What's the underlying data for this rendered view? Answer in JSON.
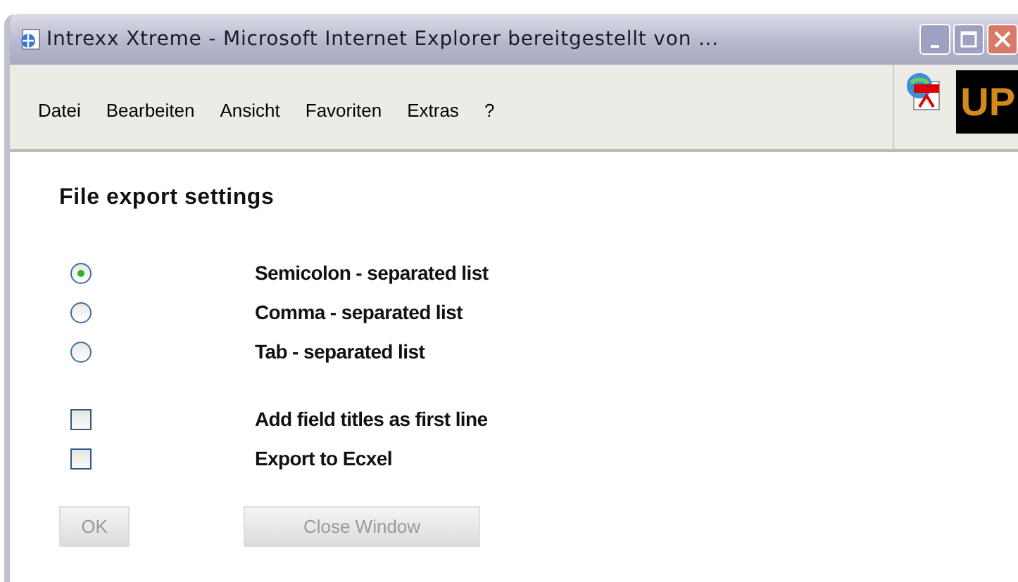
{
  "window": {
    "title": "Intrexx Xtreme - Microsoft Internet Explorer bereitgestellt von ..."
  },
  "menu": [
    "Datei",
    "Bearbeiten",
    "Ansicht",
    "Favoriten",
    "Extras",
    "?"
  ],
  "toolbar_logo": {
    "text": "UP"
  },
  "heading": "File export settings",
  "separators": [
    {
      "label": "Semicolon - separated list",
      "selected": true
    },
    {
      "label": "Comma - separated list",
      "selected": false
    },
    {
      "label": "Tab - separated list",
      "selected": false
    }
  ],
  "options": [
    {
      "label": "Add field titles as first line",
      "checked": false
    },
    {
      "label": "Export to Ecxel",
      "checked": false
    }
  ],
  "buttons": [
    {
      "label": "OK",
      "disabled": true
    },
    {
      "label": "Close Window",
      "disabled": true
    }
  ]
}
